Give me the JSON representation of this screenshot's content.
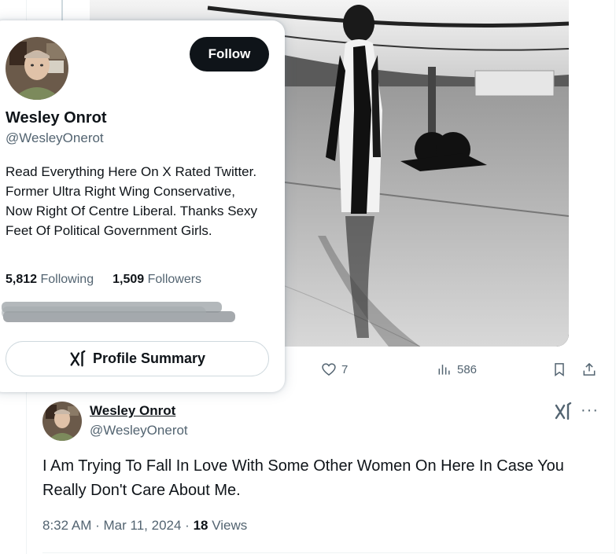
{
  "hover_card": {
    "name": "Wesley Onrot",
    "handle": "@WesleyOnerot",
    "follow_label": "Follow",
    "bio": "Read Everything Here On X Rated Twitter. Former Ultra Right Wing Conservative, Now Right Of Centre Liberal. Thanks Sexy Feet Of Political Government Girls.",
    "following_count": "5,812",
    "following_label": "Following",
    "followers_count": "1,509",
    "followers_label": "Followers",
    "summary_label": "Profile Summary"
  },
  "tweet_actions": {
    "likes": "7",
    "views": "586"
  },
  "reply": {
    "name": "Wesley Onrot",
    "handle": "@WesleyOnerot",
    "text": "I Am Trying To Fall In Love With Some Other Women On Here In Case You Really Don't Care About Me.",
    "time": "8:32 AM",
    "separator": "·",
    "date": "Mar 11, 2024",
    "views_count": "18",
    "views_label": "Views"
  },
  "icons": {
    "like": "heart-icon",
    "analytics": "bar-chart-icon",
    "bookmark": "bookmark-icon",
    "share": "share-icon",
    "grok": "grok-icon",
    "more": "more-icon",
    "summary": "grok-icon"
  },
  "colors": {
    "text_primary": "#0f1419",
    "text_secondary": "#536471",
    "border": "#cfd9de",
    "follow_bg": "#0f1419"
  }
}
